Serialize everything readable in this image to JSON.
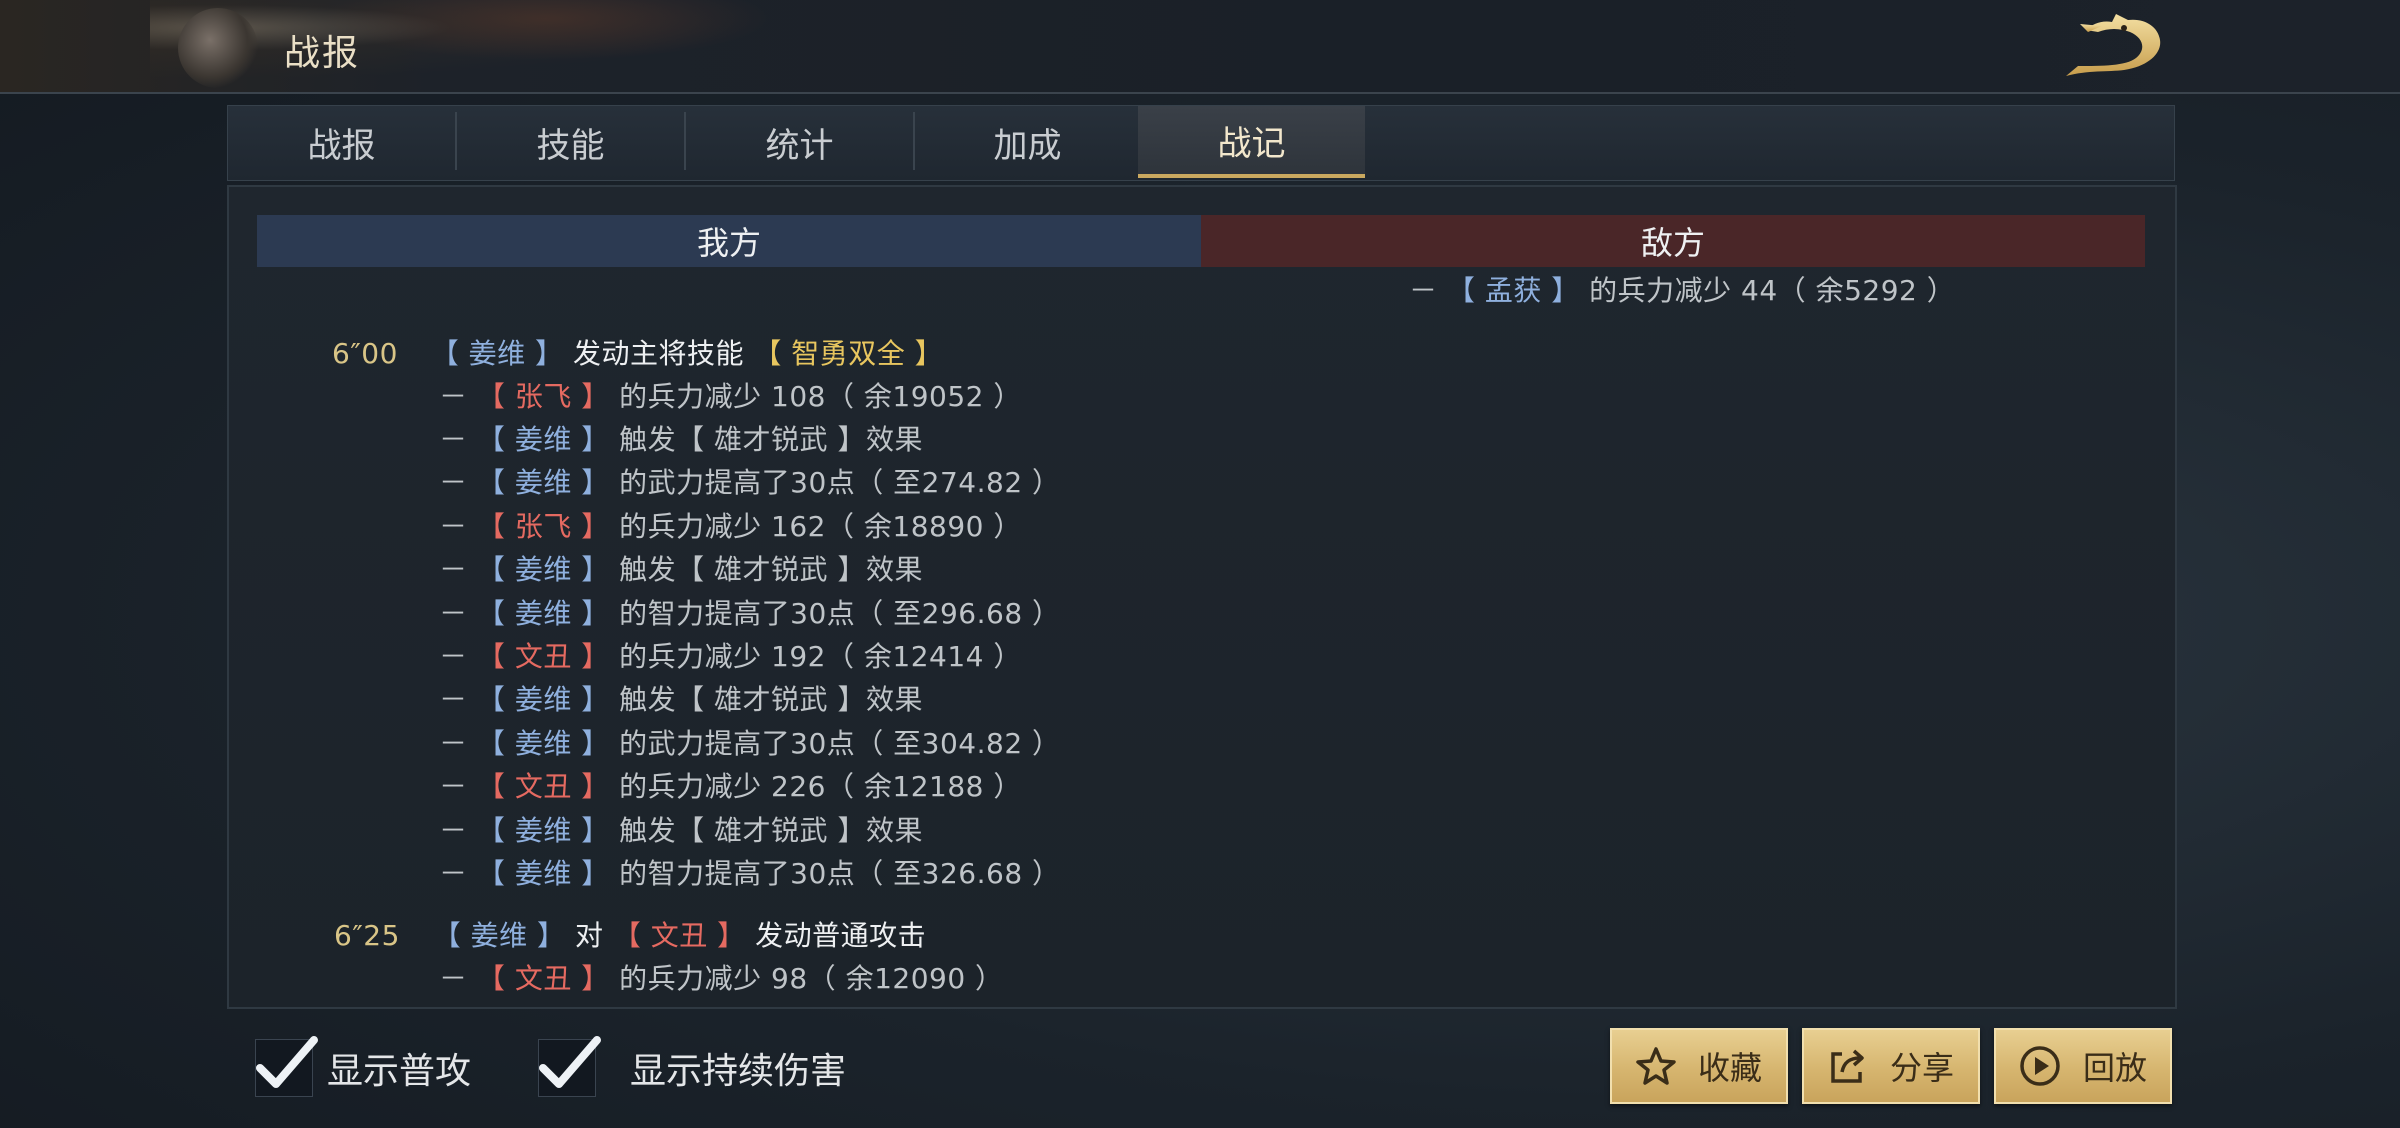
{
  "header": {
    "title": "战报"
  },
  "tabs": [
    {
      "label": "战报",
      "active": false
    },
    {
      "label": "技能",
      "active": false
    },
    {
      "label": "统计",
      "active": false
    },
    {
      "label": "加成",
      "active": false
    },
    {
      "label": "战记",
      "active": true
    }
  ],
  "columns": {
    "ours": "我方",
    "enemy": "敌方"
  },
  "enemy_log": {
    "dash": "－",
    "name": "【 孟获 】",
    "text": "的兵力减少 44（ 余5292 ）"
  },
  "events": [
    {
      "time": "6″00",
      "actor": "【 姜维 】",
      "action": "发动主将技能",
      "skill": "【 智勇双全 】",
      "lines": [
        {
          "name": "【 张飞 】",
          "side": "enemy",
          "text": "的兵力减少 108（ 余19052 ）"
        },
        {
          "name": "【 姜维 】",
          "side": "ally",
          "text": "触发【 雄才锐武 】效果"
        },
        {
          "name": "【 姜维 】",
          "side": "ally",
          "text": "的武力提高了30点（ 至274.82 ）"
        },
        {
          "name": "【 张飞 】",
          "side": "enemy",
          "text": "的兵力减少 162（ 余18890 ）"
        },
        {
          "name": "【 姜维 】",
          "side": "ally",
          "text": "触发【 雄才锐武 】效果"
        },
        {
          "name": "【 姜维 】",
          "side": "ally",
          "text": "的智力提高了30点（ 至296.68 ）"
        },
        {
          "name": "【 文丑 】",
          "side": "enemy",
          "text": "的兵力减少 192（ 余12414 ）"
        },
        {
          "name": "【 姜维 】",
          "side": "ally",
          "text": "触发【 雄才锐武 】效果"
        },
        {
          "name": "【 姜维 】",
          "side": "ally",
          "text": "的武力提高了30点（ 至304.82 ）"
        },
        {
          "name": "【 文丑 】",
          "side": "enemy",
          "text": "的兵力减少 226（ 余12188 ）"
        },
        {
          "name": "【 姜维 】",
          "side": "ally",
          "text": "触发【 雄才锐武 】效果"
        },
        {
          "name": "【 姜维 】",
          "side": "ally",
          "text": "的智力提高了30点（ 至326.68 ）"
        }
      ]
    },
    {
      "time": "6″25",
      "actor": "【 姜维 】",
      "action": "对",
      "target": "【 文丑 】",
      "action2": "发动普通攻击",
      "lines": [
        {
          "name": "【 文丑 】",
          "side": "enemy",
          "text": "的兵力减少 98（ 余12090 ）"
        }
      ]
    }
  ],
  "options": {
    "show_normal_attack": {
      "label": "显示普攻",
      "checked": true
    },
    "show_dot": {
      "label": "显示持续伤害",
      "checked": true
    }
  },
  "buttons": {
    "favorite": {
      "label": "收藏",
      "icon": "star-icon"
    },
    "share": {
      "label": "分享",
      "icon": "share-icon"
    },
    "replay": {
      "label": "回放",
      "icon": "play-icon"
    }
  },
  "colors": {
    "ally_name": "#8fb0de",
    "enemy_name": "#e56a61",
    "skill_name": "#e8c65f",
    "time": "#d9c587",
    "ours_header": "#2c3a52",
    "enemy_header": "#4a2628",
    "button_gold": "#d6b56f"
  }
}
